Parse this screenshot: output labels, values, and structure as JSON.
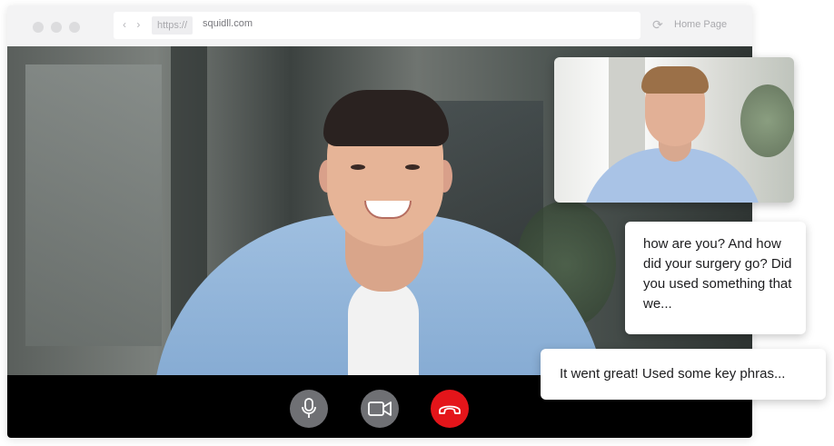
{
  "browser": {
    "nav_arrows": "‹ ›",
    "protocol_label": "https://",
    "domain": "squidll.com",
    "reload_icon": "reload-icon",
    "home_label": "Home Page"
  },
  "call": {
    "controls": [
      {
        "name": "mic-button",
        "icon": "microphone-icon",
        "color": "#6f7074"
      },
      {
        "name": "camera-button",
        "icon": "video-camera-icon",
        "color": "#6f7074"
      },
      {
        "name": "hangup-button",
        "icon": "phone-hangup-icon",
        "color": "#e4151a"
      }
    ]
  },
  "chat": {
    "incoming_message": "how are you? And how did your surgery go? Did you used something that we...",
    "outgoing_message": "It went great! Used some key phras..."
  },
  "colors": {
    "control_bar": "#000000",
    "hangup_red": "#e4151a",
    "control_grey": "#6f7074"
  }
}
